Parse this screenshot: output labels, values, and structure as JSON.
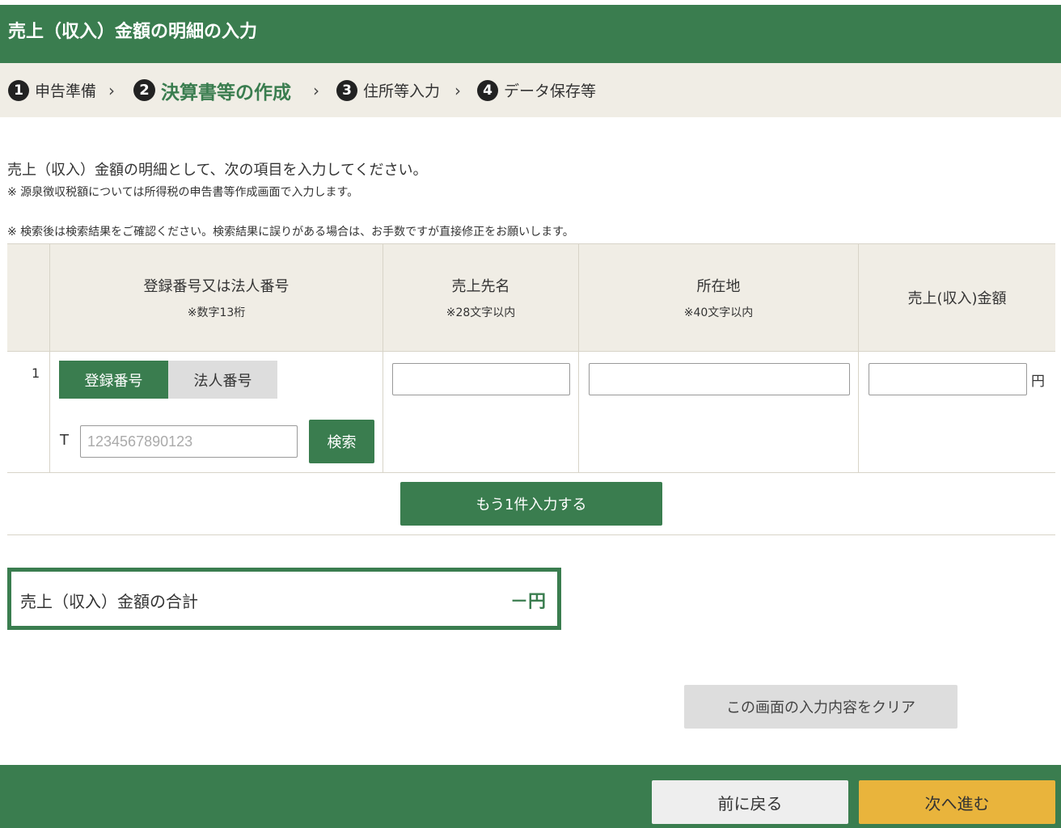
{
  "header": {
    "title": "売上（収入）金額の明細の入力"
  },
  "steps": [
    {
      "num": "1",
      "label": "申告準備"
    },
    {
      "num": "2",
      "label": "決算書等の作成"
    },
    {
      "num": "3",
      "label": "住所等入力"
    },
    {
      "num": "4",
      "label": "データ保存等"
    }
  ],
  "steps_separator": "›",
  "intro": {
    "lead": "売上（収入）金額の明細として、次の項目を入力してください。",
    "note1": "※ 源泉徴収税額については所得税の申告書等作成画面で入力します。",
    "note2": "※ 検索後は検索結果をご確認ください。検索結果に誤りがある場合は、お手数ですが直接修正をお願いします。"
  },
  "table": {
    "columns": [
      {
        "title": "登録番号又は法人番号",
        "note": "※数字13桁"
      },
      {
        "title": "売上先名",
        "note": "※28文字以内"
      },
      {
        "title": "所在地",
        "note": "※40文字以内"
      },
      {
        "title": "売上(収入)金額",
        "note": ""
      }
    ],
    "row": {
      "number": "1",
      "toggle_registration": "登録番号",
      "toggle_corporate": "法人番号",
      "t_prefix": "T",
      "number_placeholder": "1234567890123",
      "number_value": "",
      "search_label": "検索",
      "customer_value": "",
      "address_value": "",
      "amount_value": "",
      "yen_unit": "円"
    }
  },
  "add_row_label": "もう1件入力する",
  "total": {
    "label": "売上（収入）金額の合計",
    "value": "－円"
  },
  "clear_label": "この画面の入力内容をクリア",
  "footer": {
    "back_label": "前に戻る",
    "next_label": "次へ進む"
  },
  "colors": {
    "primary": "#3a7d4f",
    "step_bg": "#f0ede5",
    "next": "#e9b43c"
  }
}
